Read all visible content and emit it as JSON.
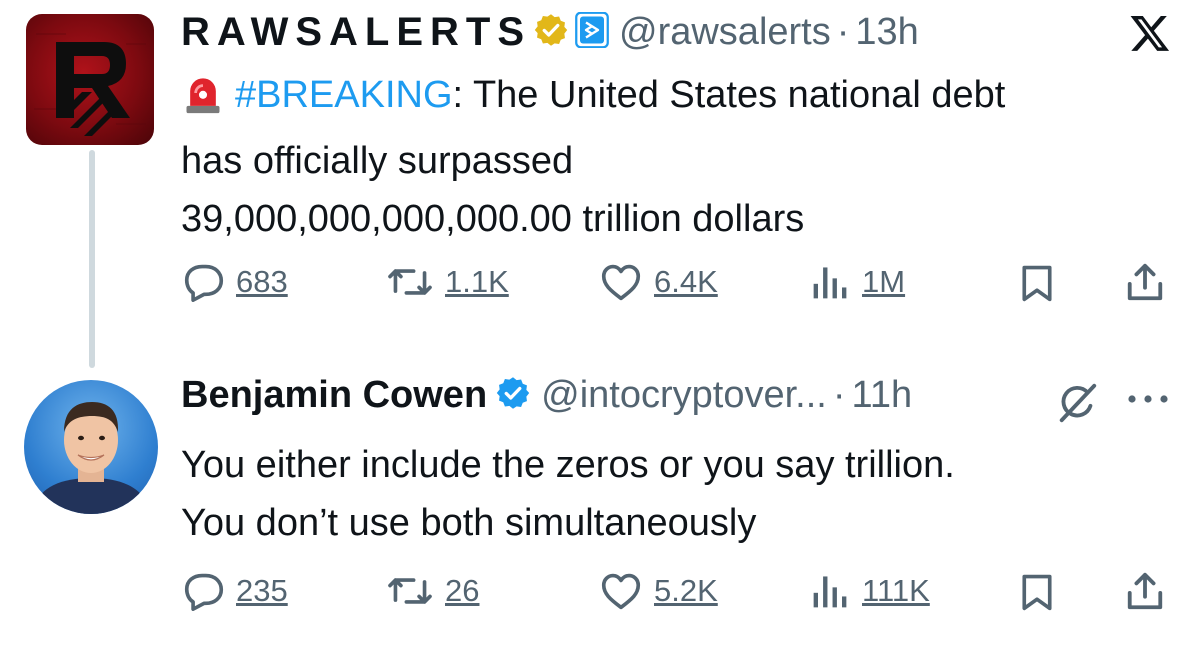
{
  "tweets": [
    {
      "name": "RAWSALERTS",
      "handle": "@rawsalerts",
      "separator": "·",
      "time": "13h",
      "siren_emoji": "🚨",
      "hashtag": "#BREAKING",
      "text_after_hashtag": ": The United States national debt",
      "text_line2": "has officially surpassed",
      "text_line3": "39,000,000,000,000.00 trillion dollars",
      "stats": {
        "replies": "683",
        "reposts": "1.1K",
        "likes": "6.4K",
        "views": "1M"
      }
    },
    {
      "name": "Benjamin Cowen",
      "handle": "@intocryptover...",
      "separator": "·",
      "time": "11h",
      "text_line1": "You either include the zeros or you say trillion.",
      "text_line2": "You don’t use both simultaneously",
      "stats": {
        "replies": "235",
        "reposts": "26",
        "likes": "5.2K",
        "views": "111K"
      }
    }
  ],
  "icons": {
    "brand": "x-logo-icon",
    "verified_gold": "gold-verified-badge-icon",
    "affiliate": "affiliate-badge-icon",
    "verified_blue": "blue-verified-badge-icon",
    "grok": "grok-icon",
    "more": "more-icon"
  },
  "colors": {
    "link": "#1d9bf0",
    "muted": "#536471",
    "text": "#0f1419",
    "gold": "#e2b719",
    "blue": "#1d9bf0",
    "thread_line": "#cfd9de"
  }
}
